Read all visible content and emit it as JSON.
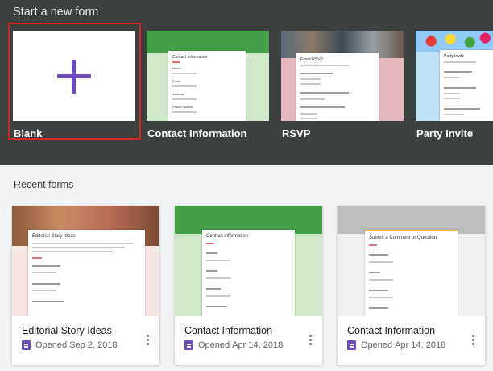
{
  "start_section": {
    "title": "Start a new form",
    "templates": [
      {
        "label": "Blank"
      },
      {
        "label": "Contact Information",
        "preview_title": "Contact information",
        "fields": [
          "Name",
          "Email",
          "Address",
          "Phone number"
        ]
      },
      {
        "label": "RSVP",
        "preview_title": "Event RSVP"
      },
      {
        "label": "Party Invite",
        "preview_title": "Party Invite"
      }
    ]
  },
  "recent_section": {
    "title": "Recent forms",
    "forms": [
      {
        "name": "Editorial Story Ideas",
        "opened": "Opened",
        "date": "Sep 2, 2018",
        "preview_title": "Editorial Story Ideas"
      },
      {
        "name": "Contact Information",
        "opened": "Opened",
        "date": "Apr 14, 2018",
        "preview_title": "Contact information"
      },
      {
        "name": "Contact Information",
        "opened": "Opened",
        "date": "Apr 14, 2018",
        "preview_title": "Submit a Comment or Question"
      }
    ]
  },
  "colors": {
    "accent": "#6f4bbd",
    "green_header": "#43a047",
    "selection": "#d32525"
  },
  "icons": [
    "plus-icon",
    "google-forms-icon",
    "more-vert-icon"
  ]
}
